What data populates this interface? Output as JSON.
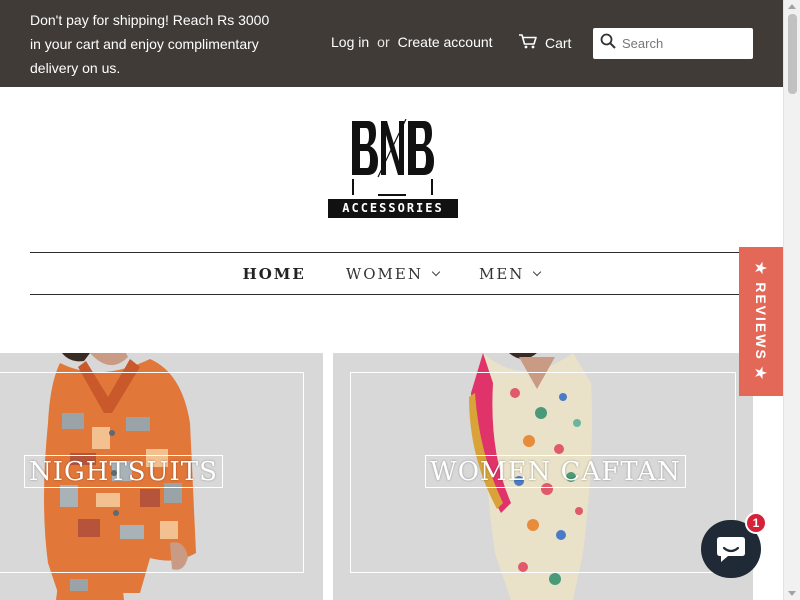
{
  "topbar": {
    "promo": "Don't pay for shipping! Reach Rs 3000 in your cart and enjoy complimentary delivery on us.",
    "login": "Log in",
    "or": "or",
    "create_account": "Create account",
    "cart_label": "Cart",
    "search_placeholder": "Search"
  },
  "logo": {
    "letters": "BNB",
    "subtitle": "ACCESSORIES"
  },
  "nav": {
    "items": [
      {
        "label": "HOME",
        "has_dropdown": false,
        "active": true
      },
      {
        "label": "WOMEN",
        "has_dropdown": true,
        "active": false
      },
      {
        "label": "MEN",
        "has_dropdown": true,
        "active": false
      }
    ]
  },
  "collections": [
    {
      "title": "NIGHTSUITS"
    },
    {
      "title": "WOMEN CAFTAN"
    }
  ],
  "reviews_tab": {
    "label": "★ REVIEWS ★"
  },
  "chat": {
    "badge_count": "1"
  },
  "colors": {
    "topbar_bg": "#403b37",
    "reviews_bg": "#e36857",
    "chat_bg": "#1f2a36",
    "badge_bg": "#d6213a"
  }
}
